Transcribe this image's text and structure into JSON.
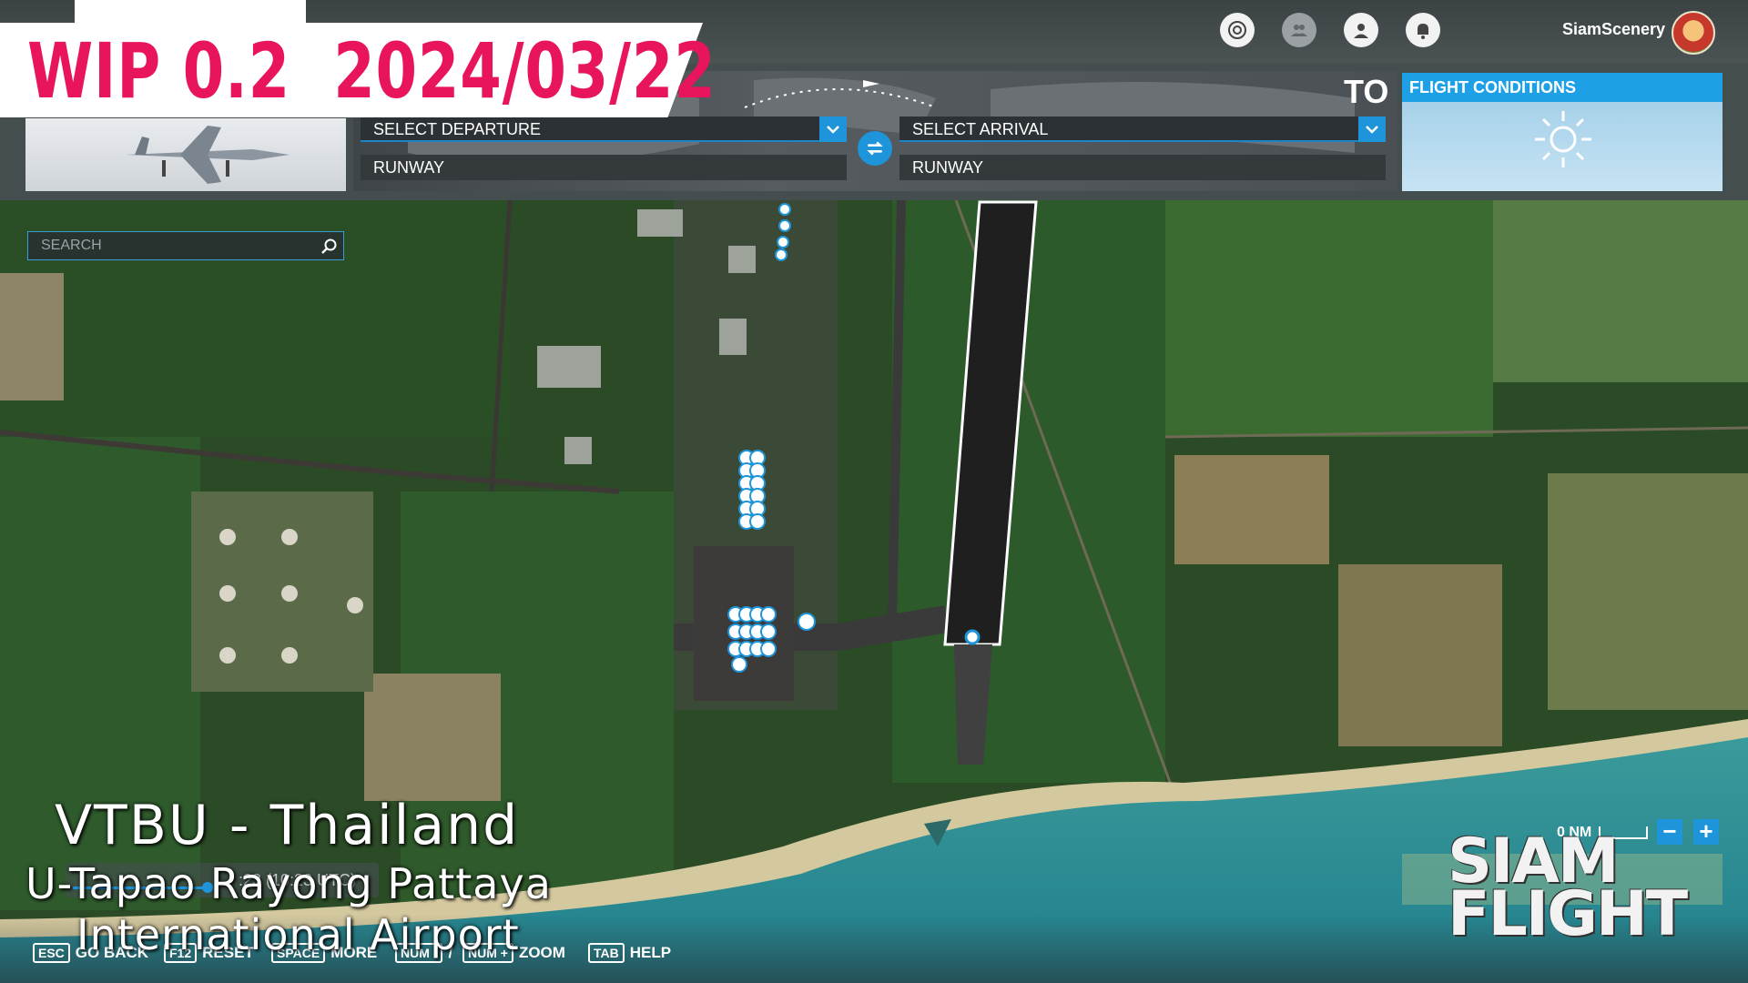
{
  "banner": {
    "text": "WIP 0.2  2024/03/22"
  },
  "user": {
    "name": "SiamScenery"
  },
  "top_icons": [
    "compass-icon",
    "multiplayer-icon",
    "profile-icon",
    "notifications-icon"
  ],
  "flight": {
    "to_label": "TO",
    "departure": {
      "placeholder": "SELECT DEPARTURE",
      "runway": "RUNWAY"
    },
    "arrival": {
      "placeholder": "SELECT ARRIVAL",
      "runway": "RUNWAY"
    }
  },
  "conditions": {
    "title": "FLIGHT CONDITIONS",
    "weather_icon": "sun-icon"
  },
  "search": {
    "placeholder": "SEARCH"
  },
  "airport": {
    "code_line": "VTBU  -  Thailand",
    "name_line1": "U-Tapao Rayong  Pattaya",
    "name_line2": "International  Airport",
    "time_partial": ":23 (10:23 UTC)"
  },
  "keys": [
    {
      "cap": "ESC",
      "label": "GO BACK"
    },
    {
      "cap": "F12",
      "label": "RESET"
    },
    {
      "cap": "SPACE",
      "label": "MORE"
    },
    {
      "cap": "NUM -",
      "label": "/"
    },
    {
      "cap": "NUM +",
      "label": "ZOOM"
    },
    {
      "cap": "TAB",
      "label": "HELP"
    }
  ],
  "scale": {
    "label": "0 NM",
    "zoom_out": "−",
    "zoom_in": "+"
  },
  "watermark": {
    "line1": "SIAM",
    "line2": "FLIGHT"
  },
  "colors": {
    "accent": "#1e95da",
    "banner_text": "#e8145c",
    "runway": "#1f1f1f"
  }
}
